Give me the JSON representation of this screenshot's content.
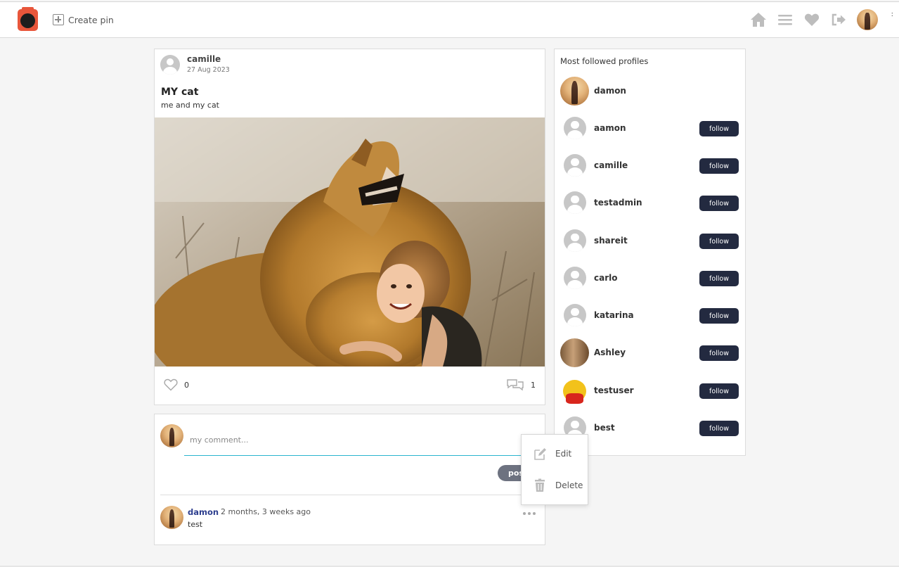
{
  "header": {
    "create_pin_label": "Create pin",
    "extra_mark": ":"
  },
  "post": {
    "author": "camille",
    "date": "27 Aug 2023",
    "title": "MY cat",
    "description": "me and my cat",
    "likes": "0",
    "comments": "1"
  },
  "comment_box": {
    "placeholder": "my comment...",
    "post_label": "post"
  },
  "comments": [
    {
      "author": "damon",
      "time": "2 months, 3 weeks ago",
      "text": "test"
    }
  ],
  "context_menu": {
    "edit_label": "Edit",
    "delete_label": "Delete"
  },
  "sidebar": {
    "title": "Most followed profiles",
    "follow_label": "follow",
    "profiles": [
      {
        "name": "damon",
        "avatar": "photo"
      },
      {
        "name": "aamon",
        "avatar": "default"
      },
      {
        "name": "camille",
        "avatar": "default"
      },
      {
        "name": "testadmin",
        "avatar": "default"
      },
      {
        "name": "shareit",
        "avatar": "default"
      },
      {
        "name": "carlo",
        "avatar": "default"
      },
      {
        "name": "katarina",
        "avatar": "default"
      },
      {
        "name": "Ashley",
        "avatar": "photo"
      },
      {
        "name": "testuser",
        "avatar": "cartoon"
      },
      {
        "name": "best",
        "avatar": "default"
      }
    ]
  },
  "colors": {
    "accent_input_line": "#2bb5cf",
    "follow_button_bg": "#232a40",
    "comment_author": "#2e3f8f",
    "logo": "#e8563b"
  }
}
